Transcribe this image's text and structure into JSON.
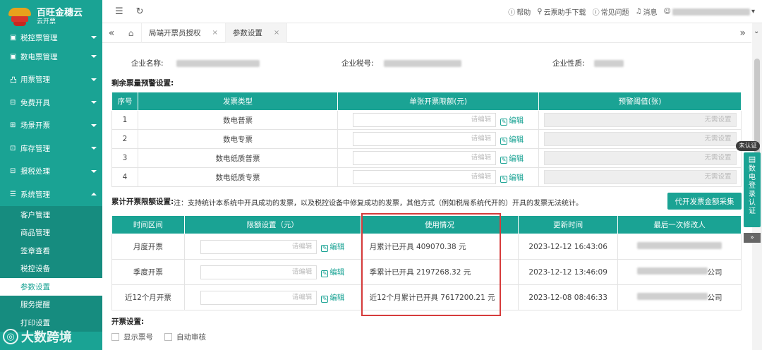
{
  "app": {
    "name": "百旺金穗云",
    "subname": "云开票"
  },
  "sidebar": {
    "items": [
      {
        "label": "税控票管理",
        "icon": "▣"
      },
      {
        "label": "数电票管理",
        "icon": "▣"
      },
      {
        "label": "用票管理",
        "icon": "凸"
      },
      {
        "label": "免费开具",
        "icon": "⊟"
      },
      {
        "label": "场景开票",
        "icon": "⊞"
      },
      {
        "label": "库存管理",
        "icon": "⊡"
      },
      {
        "label": "报税处理",
        "icon": "⊟"
      },
      {
        "label": "系统管理",
        "icon": "☰"
      }
    ],
    "subitems": [
      "客户管理",
      "商品管理",
      "签章查看",
      "税控设备",
      "参数设置",
      "服务提醒",
      "打印设置"
    ]
  },
  "topbar": {
    "help": "帮助",
    "download": "云票助手下载",
    "faq": "常见问题",
    "messages": "消息"
  },
  "tabs": [
    {
      "label": "局端开票员授权"
    },
    {
      "label": "参数设置"
    }
  ],
  "company": {
    "name_label": "企业名称:",
    "taxid_label": "企业税号:",
    "nature_label": "企业性质:"
  },
  "section1": {
    "title": "剩余票量预警设置:",
    "headers": [
      "序号",
      "发票类型",
      "单张开票限额(元)",
      "预警阈值(张)"
    ],
    "rows": [
      {
        "no": "1",
        "type": "数电普票",
        "placeholder": "请编辑",
        "edit": "编辑",
        "threshold": "无需设置"
      },
      {
        "no": "2",
        "type": "数电专票",
        "placeholder": "请编辑",
        "edit": "编辑",
        "threshold": "无需设置"
      },
      {
        "no": "3",
        "type": "数电纸质普票",
        "placeholder": "请编辑",
        "edit": "编辑",
        "threshold": "无需设置"
      },
      {
        "no": "4",
        "type": "数电纸质专票",
        "placeholder": "请编辑",
        "edit": "编辑",
        "threshold": "无需设置"
      }
    ]
  },
  "section2": {
    "title": "累计开票限额设置:",
    "note": "注：支持统计本系统中开具成功的发票，以及税控设备中修复成功的发票，其他方式（例如税局系统代开的）开具的发票无法统计。",
    "button": "代开发票金额采集",
    "headers": [
      "时间区间",
      "限额设置（元）",
      "使用情况",
      "更新时间",
      "最后一次修改人"
    ],
    "rows": [
      {
        "period": "月度开票",
        "placeholder": "请编辑",
        "edit": "编辑",
        "usage": "月累计已开具 409070.38 元",
        "updated": "2023-12-12 16:43:06",
        "modifier": ""
      },
      {
        "period": "季度开票",
        "placeholder": "请编辑",
        "edit": "编辑",
        "usage": "季累计已开具 2197268.32 元",
        "updated": "2023-12-12 13:46:09",
        "modifier": "公司"
      },
      {
        "period": "近12个月开票",
        "placeholder": "请编辑",
        "edit": "编辑",
        "usage": "近12个月累计已开具 7617200.21 元",
        "updated": "2023-12-08 08:46:33",
        "modifier": "公司"
      }
    ]
  },
  "section3": {
    "title": "开票设置:",
    "options": [
      "显示票号",
      "自动审核"
    ]
  },
  "float": {
    "tag": "未认证",
    "panel": "数电登录认证"
  },
  "watermark": "大数跨境"
}
